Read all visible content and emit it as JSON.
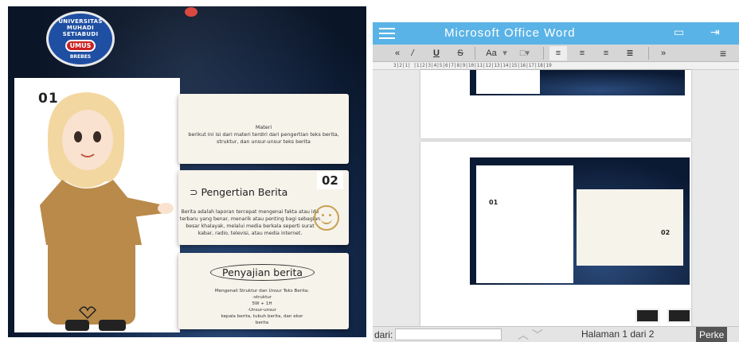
{
  "slide": {
    "logo": {
      "ring": "UNIVERSITAS MUHADI SETIABUDI",
      "badge": "UMUS",
      "sub": "BREBES"
    },
    "num01": "01",
    "num02": "02",
    "card1": {
      "title": "Materi",
      "text": "berikut ini isi dari materi terdiri dari pengertian teks berita, struktur, dan unsur-unsur teks berita"
    },
    "card2": {
      "title": "Pengertian Berita",
      "text": "Berita adalah laporan tercepat mengenai fakta atau ide terbaru yang benar, menarik atau penting bagi sebagian besar khalayak, melalui media berkala seperti surat kabar, radio, televisi, atau media internet."
    },
    "card3": {
      "title": "Penyajian berita",
      "lines": [
        "Mengenali Struktur dan Unsur Teks Berita:",
        "-struktur",
        "5W + 1H",
        "-Unsur-unsur",
        "kepala berita, tubuh berita, dan ekor",
        "berita"
      ]
    }
  },
  "app": {
    "title": "Microsoft Office Word",
    "toolbar": {
      "back": "«",
      "italic": "/",
      "underline": "U",
      "strike": "S",
      "font": "Aa",
      "more": "»"
    },
    "ruler": "3|2|1|  |1|2|3|4|5|6|7|8|9|10|11|12|13|14|15|16|17|18|19",
    "mini01": "01",
    "mini02": "02",
    "statusbar": {
      "label": "dari:",
      "page_info": "Halaman 1 dari 2",
      "button": "Perke"
    }
  }
}
